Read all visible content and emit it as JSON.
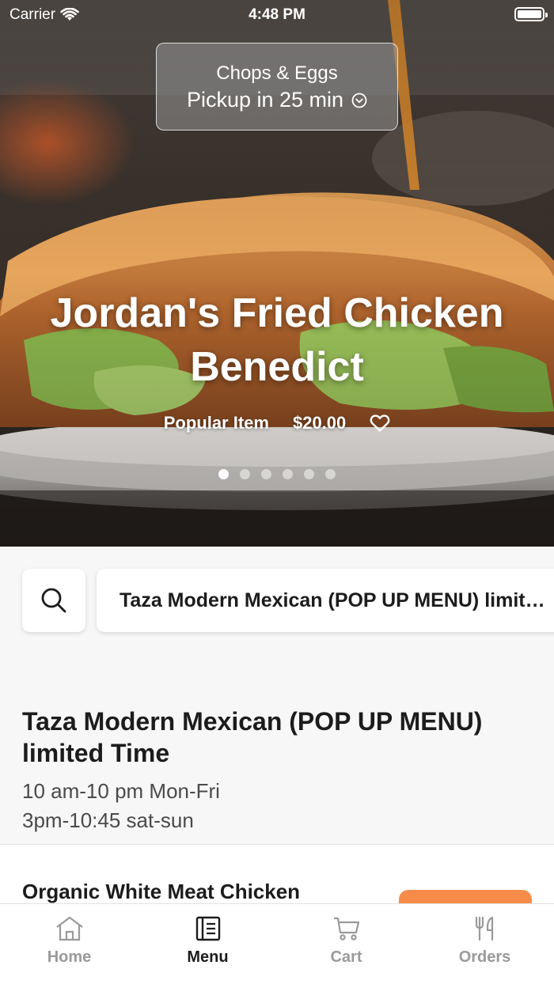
{
  "status_bar": {
    "carrier": "Carrier",
    "time": "4:48 PM"
  },
  "pickup": {
    "restaurant": "Chops & Eggs",
    "time_label": "Pickup in 25 min"
  },
  "hero": {
    "title": "Jordan's Fried Chicken Benedict",
    "tag": "Popular Item",
    "price": "$20.00",
    "carousel_total": 6,
    "carousel_active": 0
  },
  "search": {
    "icon": "search-icon",
    "category": "Taza Modern Mexican (POP UP MENU) limited Time"
  },
  "section": {
    "title": "Taza Modern Mexican (POP UP MENU) limited Time",
    "hours_line1": "10 am-10 pm Mon-Fri",
    "hours_line2": "3pm-10:45 sat-sun"
  },
  "items": [
    {
      "name": "Organic White Meat Chicken"
    }
  ],
  "tabs": [
    {
      "label": "Home",
      "icon": "home-icon",
      "active": false
    },
    {
      "label": "Menu",
      "icon": "menu-icon",
      "active": true
    },
    {
      "label": "Cart",
      "icon": "cart-icon",
      "active": false
    },
    {
      "label": "Orders",
      "icon": "orders-icon",
      "active": false
    }
  ],
  "colors": {
    "accent": "#f78c4a",
    "active_tab": "#1c1c1c",
    "inactive_tab": "#9a9a9a"
  }
}
